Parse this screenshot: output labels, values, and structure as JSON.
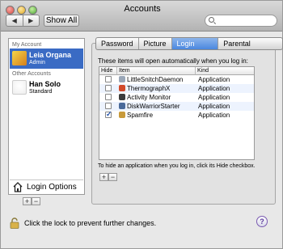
{
  "window": {
    "title": "Accounts"
  },
  "toolbar": {
    "back": "◀",
    "forward": "▶",
    "show_all": "Show All",
    "search_value": "",
    "search_placeholder": ""
  },
  "sidebar": {
    "my_account_header": "My Account",
    "other_accounts_header": "Other Accounts",
    "users": [
      {
        "name": "Leia Organa",
        "role": "Admin",
        "selected": true
      },
      {
        "name": "Han Solo",
        "role": "Standard",
        "selected": false
      }
    ],
    "login_options_label": "Login Options",
    "add": "+",
    "remove": "−"
  },
  "tabs": [
    {
      "label": "Password",
      "active": false
    },
    {
      "label": "Picture",
      "active": false
    },
    {
      "label": "Login Items",
      "active": true
    },
    {
      "label": "Parental Controls",
      "active": false
    }
  ],
  "login_items": {
    "intro": "These items will open automatically when you log in:",
    "columns": {
      "hide": "Hide",
      "item": "Item",
      "kind": "Kind"
    },
    "rows": [
      {
        "hide": false,
        "name": "LittleSnitchDaemon",
        "kind": "Application",
        "icon": "little-snitch-icon",
        "color": "#9aa7b8"
      },
      {
        "hide": false,
        "name": "ThermographX",
        "kind": "Application",
        "icon": "thermograph-icon",
        "color": "#d24a2a"
      },
      {
        "hide": false,
        "name": "Activity Monitor",
        "kind": "Application",
        "icon": "activity-monitor-icon",
        "color": "#3c3c3c"
      },
      {
        "hide": false,
        "name": "DiskWarriorStarter",
        "kind": "Application",
        "icon": "diskwarrior-icon",
        "color": "#4a6a9a"
      },
      {
        "hide": true,
        "name": "Spamfire",
        "kind": "Application",
        "icon": "spamfire-icon",
        "color": "#c89a3a"
      }
    ],
    "help": "To hide an application when you log in, click its Hide checkbox.",
    "add": "+",
    "remove": "−"
  },
  "footer": {
    "lock_text": "Click the lock to prevent further changes.",
    "help": "?"
  },
  "colors": {
    "selection": "#3a6bc4",
    "active_tab": "#4a87df"
  }
}
